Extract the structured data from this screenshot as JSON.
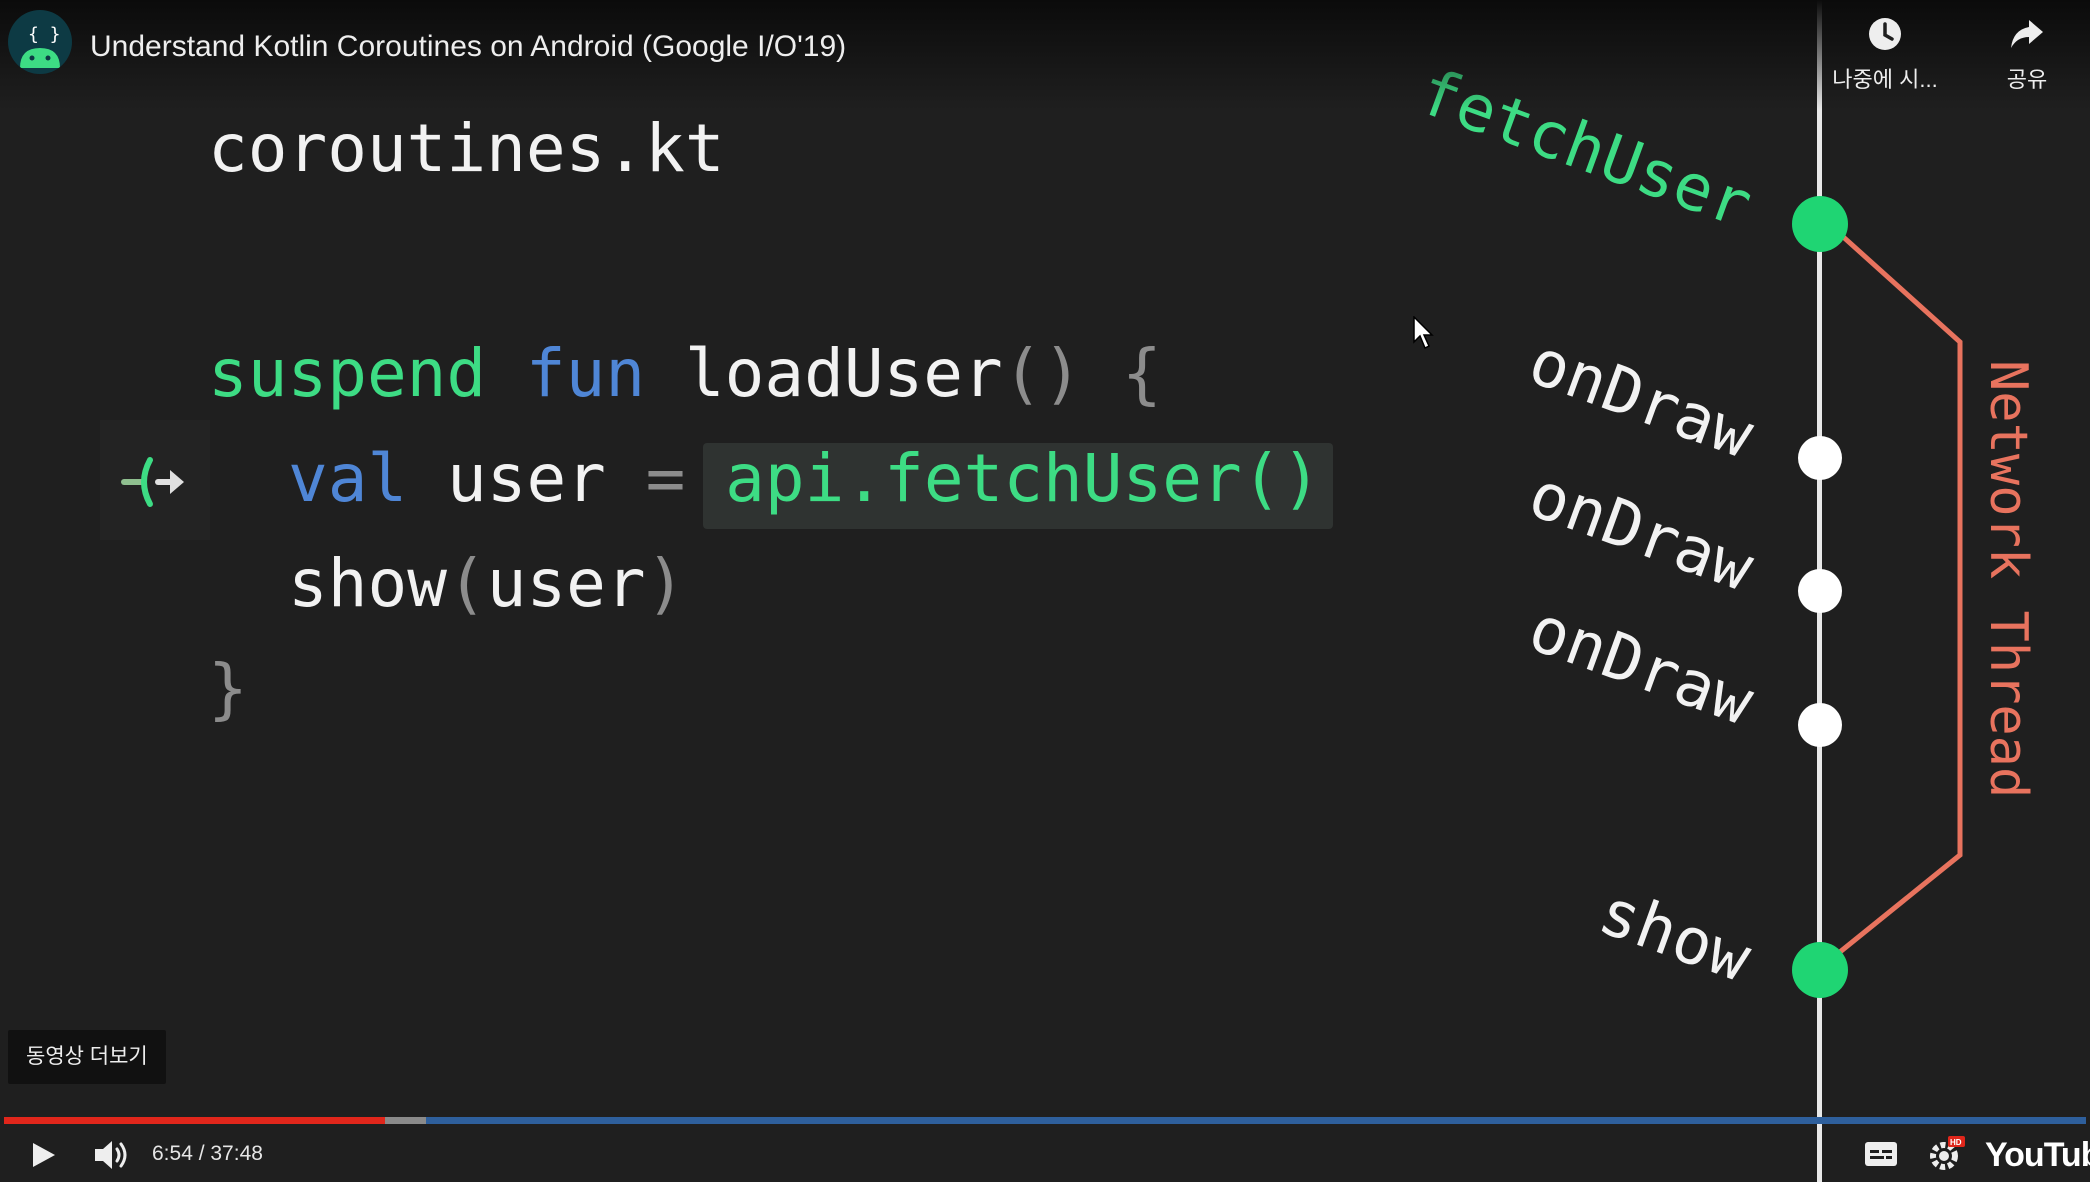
{
  "header": {
    "video_title": "Understand Kotlin Coroutines on Android (Google I/O'19)",
    "actions": [
      {
        "label": "나중에 시...",
        "icon": "clock-icon"
      },
      {
        "label": "공유",
        "icon": "share-icon"
      }
    ]
  },
  "slide": {
    "filename": "coroutines.kt",
    "code": {
      "kw_suspend": "suspend",
      "kw_fun": "fun",
      "fn_name": "loadUser",
      "parens": "()",
      "open_brace": "{",
      "kw_val": "val",
      "var_user": "user",
      "equals": "=",
      "fetch_call": "api.fetchUser()",
      "show_fn": "show",
      "paren_open": "(",
      "show_arg": "user",
      "paren_close": ")",
      "close_brace": "}"
    },
    "timeline": {
      "fetch_label": "fetchUser",
      "ondraw_labels": [
        "onDraw",
        "onDraw",
        "onDraw"
      ],
      "show_label": "show",
      "network_label": "Network Thread"
    }
  },
  "overlay": {
    "more_videos": "동영상 더보기"
  },
  "player": {
    "current_time": "6:54",
    "duration": "37:48",
    "time_display": "6:54 / 37:48",
    "progress_played_fraction": 0.183,
    "progress_loaded_fraction": 0.153,
    "logo": "YouTube"
  },
  "colors": {
    "accent_green": "#3ddc84",
    "keyword_blue": "#4f86d6",
    "network_red": "#e8735e",
    "progress_red": "#e0261b"
  }
}
